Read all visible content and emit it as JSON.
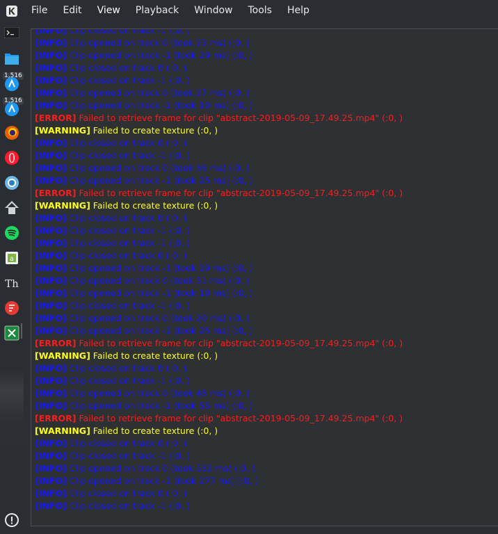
{
  "menubar": {
    "items": [
      "File",
      "Edit",
      "View",
      "Playback",
      "Window",
      "Tools",
      "Help"
    ],
    "active": "View"
  },
  "dock": {
    "badges": [
      "1,516",
      "1,516"
    ],
    "icons": [
      "terminal-icon",
      "folder-icon",
      "kde-app-icon",
      "kde-app-icon-2",
      "firefox-icon",
      "opera-icon",
      "browser-icon",
      "inkscape-icon",
      "spotify-icon",
      "android-app-icon",
      "typography-icon",
      "media-player-icon",
      "spreadsheet-icon",
      "power-icon"
    ]
  },
  "colors": {
    "info": "#1515ff",
    "error": "#ff1a1a",
    "warning": "#ffff1a"
  },
  "log": [
    {
      "level": "info",
      "tag": "[INFO]",
      "msg": "Clip closed on track -1 (:0, )"
    },
    {
      "level": "info",
      "tag": "[INFO]",
      "msg": "Clip opened on track 0 (took 23 ms) (:0, )"
    },
    {
      "level": "info",
      "tag": "[INFO]",
      "msg": "Clip opened on track -1 (took 29 ms) (:0, )"
    },
    {
      "level": "info",
      "tag": "[INFO]",
      "msg": "Clip closed on track 0 (:0, )"
    },
    {
      "level": "info",
      "tag": "[INFO]",
      "msg": "Clip closed on track -1 (:0, )"
    },
    {
      "level": "info",
      "tag": "[INFO]",
      "msg": "Clip opened on track 0 (took 27 ms) (:0, )"
    },
    {
      "level": "info",
      "tag": "[INFO]",
      "msg": "Clip opened on track -1 (took 19 ms) (:0, )"
    },
    {
      "level": "error",
      "tag": "[ERROR]",
      "msg": "Failed to retrieve frame for clip \"abstract-2019-05-09_17.49.25.mp4\" (:0, )"
    },
    {
      "level": "warning",
      "tag": "[WARNING]",
      "msg": "Failed to create texture (:0, )"
    },
    {
      "level": "info",
      "tag": "[INFO]",
      "msg": "Clip closed on track 0 (:0, )"
    },
    {
      "level": "info",
      "tag": "[INFO]",
      "msg": "Clip closed on track -1 (:0, )"
    },
    {
      "level": "info",
      "tag": "[INFO]",
      "msg": "Clip opened on track 0 (took 36 ms) (:0, )"
    },
    {
      "level": "info",
      "tag": "[INFO]",
      "msg": "Clip opened on track -1 (took 25 ms) (:0, )"
    },
    {
      "level": "error",
      "tag": "[ERROR]",
      "msg": "Failed to retrieve frame for clip \"abstract-2019-05-09_17.49.25.mp4\" (:0, )"
    },
    {
      "level": "warning",
      "tag": "[WARNING]",
      "msg": "Failed to create texture (:0, )"
    },
    {
      "level": "info",
      "tag": "[INFO]",
      "msg": "Clip closed on track 0 (:0, )"
    },
    {
      "level": "info",
      "tag": "[INFO]",
      "msg": "Clip closed on track -1 (:0, )"
    },
    {
      "level": "info",
      "tag": "[INFO]",
      "msg": "Clip closed on track -1 (:0, )"
    },
    {
      "level": "info",
      "tag": "[INFO]",
      "msg": "Clip closed on track 0 (:0, )"
    },
    {
      "level": "info",
      "tag": "[INFO]",
      "msg": "Clip opened on track -1 (took 29 ms) (:0, )"
    },
    {
      "level": "info",
      "tag": "[INFO]",
      "msg": "Clip opened on track 0 (took 31 ms) (:0, )"
    },
    {
      "level": "info",
      "tag": "[INFO]",
      "msg": "Clip opened on track -1 (took 19 ms) (:0, )"
    },
    {
      "level": "info",
      "tag": "[INFO]",
      "msg": "Clip closed on track -1 (:0, )"
    },
    {
      "level": "info",
      "tag": "[INFO]",
      "msg": "Clip opened on track 0 (took 20 ms) (:0, )"
    },
    {
      "level": "info",
      "tag": "[INFO]",
      "msg": "Clip opened on track -1 (took 25 ms) (:0, )"
    },
    {
      "level": "error",
      "tag": "[ERROR]",
      "msg": "Failed to retrieve frame for clip \"abstract-2019-05-09_17.49.25.mp4\" (:0, )"
    },
    {
      "level": "warning",
      "tag": "[WARNING]",
      "msg": "Failed to create texture (:0, )"
    },
    {
      "level": "info",
      "tag": "[INFO]",
      "msg": "Clip closed on track 0 (:0, )"
    },
    {
      "level": "info",
      "tag": "[INFO]",
      "msg": "Clip closed on track -1 (:0, )"
    },
    {
      "level": "info",
      "tag": "[INFO]",
      "msg": "Clip opened on track 0 (took 48 ms) (:0, )"
    },
    {
      "level": "info",
      "tag": "[INFO]",
      "msg": "Clip opened on track -1 (took 55 ms) (:0, )"
    },
    {
      "level": "error",
      "tag": "[ERROR]",
      "msg": "Failed to retrieve frame for clip \"abstract-2019-05-09_17.49.25.mp4\" (:0, )"
    },
    {
      "level": "warning",
      "tag": "[WARNING]",
      "msg": "Failed to create texture (:0, )"
    },
    {
      "level": "info",
      "tag": "[INFO]",
      "msg": "Clip closed on track 0 (:0, )"
    },
    {
      "level": "info",
      "tag": "[INFO]",
      "msg": "Clip closed on track -1 (:0, )"
    },
    {
      "level": "info",
      "tag": "[INFO]",
      "msg": "Clip opened on track 0 (took 532 ms) (:0, )"
    },
    {
      "level": "info",
      "tag": "[INFO]",
      "msg": "Clip opened on track -1 (took 277 ms) (:0, )"
    },
    {
      "level": "info",
      "tag": "[INFO]",
      "msg": "Clip closed on track 0 (:0, )"
    },
    {
      "level": "info",
      "tag": "[INFO]",
      "msg": "Clip closed on track -1 (:0, )"
    }
  ]
}
